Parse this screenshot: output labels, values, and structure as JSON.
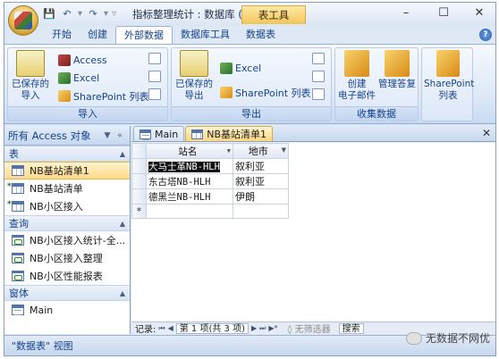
{
  "titlebar": {
    "title": "指标整理统计 : 数据库 (...",
    "context_tab": "表工具",
    "minimize": "–",
    "maximize": "☐",
    "close": "✕"
  },
  "ribbon_tabs": [
    "开始",
    "创建",
    "外部数据",
    "数据库工具",
    "数据表"
  ],
  "ribbon": {
    "import_group": {
      "label": "导入",
      "saved_import": "已保存的\n导入",
      "access": "Access",
      "excel": "Excel",
      "sharepoint": "SharePoint 列表"
    },
    "export_group": {
      "label": "导出",
      "saved_export": "已保存的\n导出",
      "excel": "Excel",
      "sharepoint": "SharePoint 列表"
    },
    "collect_group": {
      "label": "收集数据",
      "create_email": "创建\n电子邮件",
      "manage_replies": "管理答复"
    },
    "sharepoint_group": {
      "label": "SharePoint\n列表"
    }
  },
  "nav": {
    "header": "所有 Access 对象",
    "sections": [
      {
        "title": "表",
        "items": [
          "NB基站清单1",
          "NB基站清单",
          "NB小区接入"
        ]
      },
      {
        "title": "查询",
        "items": [
          "NB小区接入统计-全...",
          "NB小区接入整理",
          "NB小区性能报表"
        ]
      },
      {
        "title": "窗体",
        "items": [
          "Main"
        ]
      }
    ]
  },
  "doc_tabs": [
    "Main",
    "NB基站清单1"
  ],
  "datasheet": {
    "columns": [
      "站名",
      "地市"
    ],
    "rows": [
      [
        "大马士革NB-HLH",
        "叙利亚"
      ],
      [
        "东古塔NB-HLH",
        "叙利亚"
      ],
      [
        "德黑兰NB-HLH",
        "伊朗"
      ]
    ],
    "new_row_marker": "*"
  },
  "record_nav": {
    "label": "记录:",
    "position": "第 1 项(共 3 项)",
    "filter": "无筛选器",
    "search": "搜索"
  },
  "status": {
    "view": "\"数据表\" 视图",
    "watermark": "无数据不网优"
  }
}
